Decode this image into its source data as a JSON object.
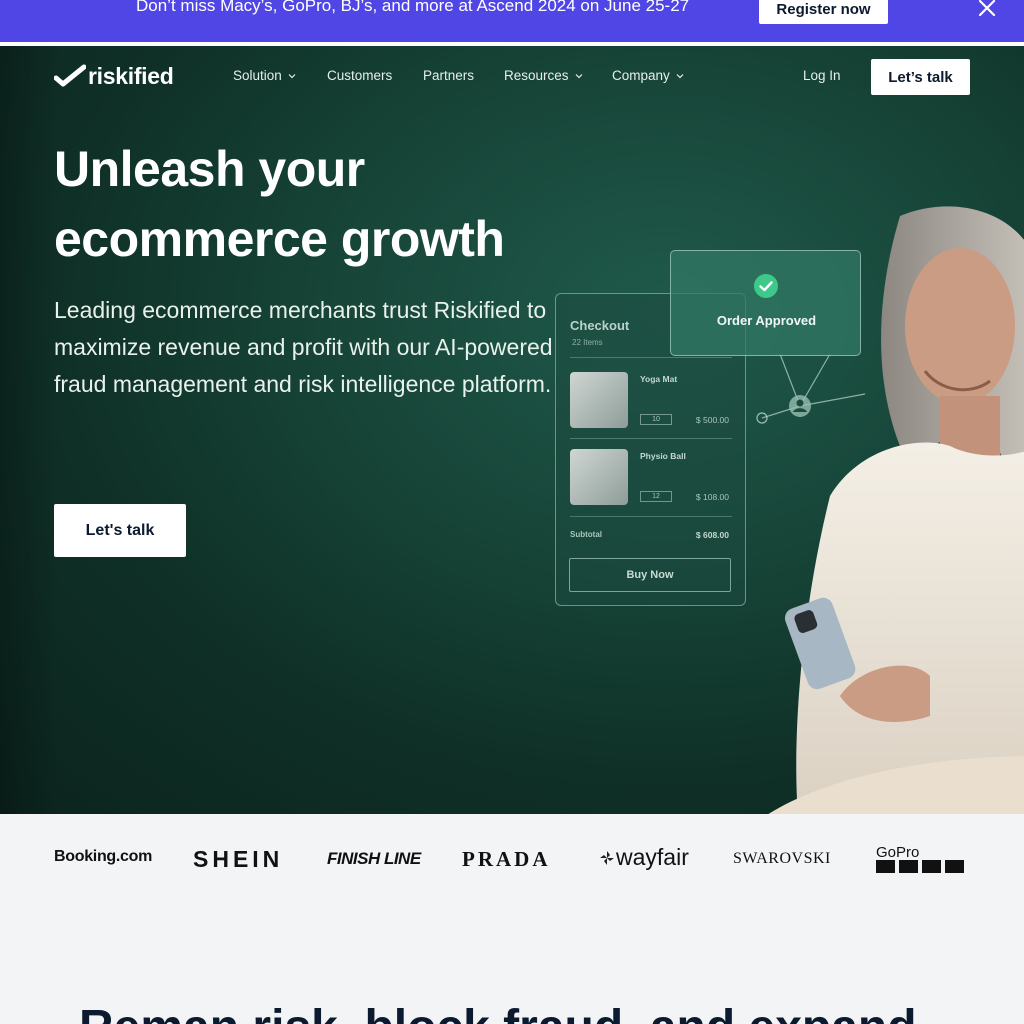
{
  "banner": {
    "text": "Don’t miss Macy’s, GoPro, BJ’s, and more at Ascend 2024 on June 25-27",
    "button": "Register now",
    "close_icon": "close-icon"
  },
  "nav": {
    "logo": "riskified",
    "items": [
      {
        "label": "Solution",
        "dropdown": true
      },
      {
        "label": "Customers",
        "dropdown": false
      },
      {
        "label": "Partners",
        "dropdown": false
      },
      {
        "label": "Resources",
        "dropdown": true
      },
      {
        "label": "Company",
        "dropdown": true
      }
    ],
    "login": "Log In",
    "cta": "Let’s talk"
  },
  "hero": {
    "title_line1": "Unleash your",
    "title_line2": "ecommerce growth",
    "subtitle": "Leading ecommerce merchants trust Riskified to maximize revenue and profit with our AI-powered fraud management and risk intelligence platform.",
    "cta": "Let's talk"
  },
  "checkout": {
    "title": "Checkout",
    "count": "22 Items",
    "items": [
      {
        "name": "Yoga Mat",
        "qty": "10",
        "price": "$ 500.00"
      },
      {
        "name": "Physio Ball",
        "qty": "12",
        "price": "$ 108.00"
      }
    ],
    "subtotal_label": "Subtotal",
    "subtotal_value": "$ 608.00",
    "buy_button": "Buy Now",
    "approved": "Order Approved"
  },
  "logos": [
    "Booking.com",
    "SHEIN",
    "FINISH LINE",
    "PRADA",
    "wayfair",
    "SWAROVSKI",
    "GoPro"
  ],
  "next_section_heading": "Reman risk, block fraud, and expand"
}
